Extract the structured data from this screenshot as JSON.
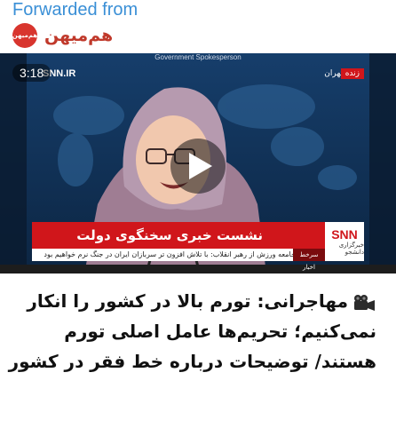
{
  "forward": {
    "label": "Forwarded from",
    "channel_name": "هم‌میهن",
    "avatar_text": "هم‌میهن"
  },
  "video": {
    "duration": "3:18",
    "play_icon": "play-icon",
    "top_badge": "SNN.IR",
    "org_caption": "Government Spokesperson",
    "live_tag": "زنده",
    "city_tag": "تهران",
    "banner_text": "نشست خبری سخنگوی دولت",
    "logo_main": "SNN",
    "logo_sub": "خبرگزاری دانشجو",
    "ticker_label": "سرخط اخبار",
    "ticker_text": "قدردانی جامعه ورزش از رهبر انقلاب: با تلاش افزون تر سربازان ایران در جنگ نرم خواهیم بود"
  },
  "post": {
    "icon": "movie-camera-icon",
    "caption": "مهاجرانی: تورم بالا در کشور را انکار نمی‌کنیم؛ تحریم‌ها عامل اصلی تورم هستند/ توضیحات درباره خط فقر در کشور"
  },
  "colors": {
    "link_blue": "#3a8fd6",
    "channel_red": "#c0392b",
    "banner_red": "#d0161b",
    "backdrop_blue": "#0f2e52"
  }
}
